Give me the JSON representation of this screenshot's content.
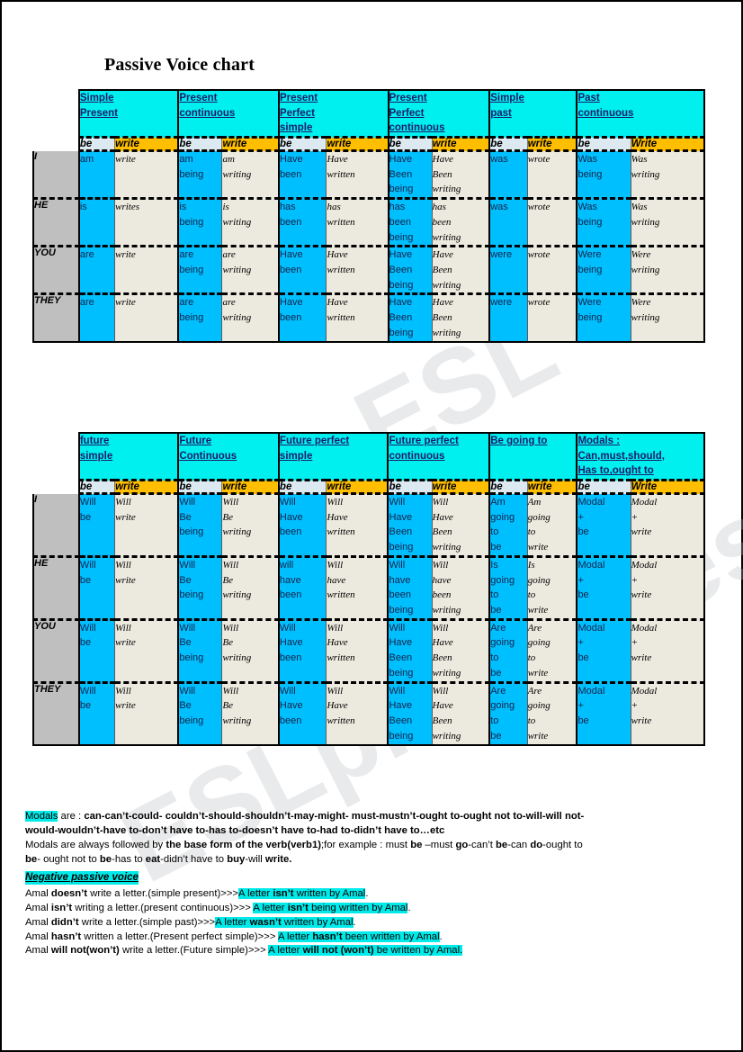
{
  "title": "Passive Voice chart",
  "watermark": [
    "ESLprintables.com",
    "ESL"
  ],
  "columns_sub": {
    "be": "be",
    "write": "write",
    "write_cap": "Write"
  },
  "table1": {
    "tenses": [
      {
        "lines": [
          "Simple",
          "Present"
        ]
      },
      {
        "lines": [
          "Present",
          "continuous"
        ]
      },
      {
        "lines": [
          "Present",
          "Perfect",
          "simple"
        ]
      },
      {
        "lines": [
          "Present",
          "Perfect",
          "continuous"
        ]
      },
      {
        "lines": [
          "Simple",
          "past"
        ]
      },
      {
        "lines": [
          "Past",
          "continuous"
        ]
      }
    ],
    "subheaders": [
      "be",
      "write",
      "be",
      "write",
      "be",
      "write",
      "be",
      "write",
      "be",
      "write",
      "be",
      "Write"
    ],
    "rows": [
      {
        "label": "I",
        "cells": [
          "am",
          "write",
          "am being",
          "am writing",
          "Have been",
          "Have written",
          "Have Been being",
          "Have Been writing",
          "was",
          "wrote",
          "Was being",
          "Was writing"
        ]
      },
      {
        "label": "HE",
        "cells": [
          "is",
          "writes",
          "is being",
          "is writing",
          "has been",
          "has written",
          "has been being",
          "has been writing",
          "was",
          "wrote",
          "Was being",
          "Was writing"
        ]
      },
      {
        "label": "YOU",
        "cells": [
          "are",
          "write",
          "are being",
          "are writing",
          "Have been",
          "Have written",
          "Have Been being",
          "Have Been writing",
          "were",
          "wrote",
          "Were being",
          "Were writing"
        ]
      },
      {
        "label": "THEY",
        "cells": [
          "are",
          "write",
          "are being",
          "are writing",
          "Have been",
          "Have written",
          "Have Been being",
          "Have Been writing",
          "were",
          "wrote",
          "Were being",
          "Were writing"
        ]
      }
    ]
  },
  "table2": {
    "tenses": [
      {
        "lines": [
          "future",
          "simple"
        ]
      },
      {
        "lines": [
          "Future",
          "Continuous"
        ]
      },
      {
        "lines": [
          "Future perfect",
          " simple"
        ]
      },
      {
        "lines": [
          "Future perfect",
          "continuous"
        ]
      },
      {
        "lines": [
          "Be going to"
        ]
      },
      {
        "lines": [
          "Modals :",
          "Can,must,should,",
          "Has to,ought to"
        ]
      }
    ],
    "subheaders": [
      "be",
      "write",
      "be",
      "write",
      "be",
      "write",
      "be",
      "write",
      "be",
      "write",
      "be",
      "Write"
    ],
    "rows": [
      {
        "label": "I",
        "cells": [
          "Will be",
          "Will write",
          "Will Be being",
          "Will Be writing",
          "Will Have been",
          "Will Have written",
          "Will Have Been being",
          "Will Have Been writing",
          "Am going to be",
          "Am going to write",
          "Modal + be",
          "Modal + write"
        ]
      },
      {
        "label": "HE",
        "cells": [
          "Will be",
          "Will write",
          "Will Be being",
          "Will Be writing",
          "will have been",
          "Will have written",
          "Will have been being",
          "Will have been writing",
          "Is going to be",
          "Is going to write",
          "Modal + be",
          "Modal + write"
        ]
      },
      {
        "label": "YOU",
        "cells": [
          "Will be",
          "Will write",
          "Will Be being",
          "Will Be writing",
          "Will Have been",
          "Will Have written",
          "Will Have Been being",
          "Will Have Been writing",
          "Are going to be",
          "Are going to write",
          "Modal + be",
          "Modal + write"
        ]
      },
      {
        "label": "THEY",
        "cells": [
          "Will be",
          "Will write",
          "Will Be being",
          "Will Be writing",
          "Will Have been",
          "Will Have written",
          "Will Have Been being",
          "Will Have Been writing",
          "Are going to be",
          "Are going to write",
          "Modal + be",
          "Modal + write"
        ]
      }
    ]
  },
  "notes": {
    "modals_word": "Modals",
    "modals_are": " are : ",
    "modals_list_line1": "can-can’t-could- couldn’t-should-shouldn’t-may-might- must-mustn’t-ought to-ought not to-will-will not-",
    "modals_list_line2": "would-wouldn’t-have to-don’t have to-has to-doesn’t have to-had to-didn’t have to…etc",
    "followed_pre": "Modals are always followed by ",
    "followed_bold": "the base form of the verb(verb1)",
    "followed_post": ";for example : must ",
    "ex_be1": "be",
    "ex_mid1": " –must ",
    "ex_go": "go",
    "ex_mid2": "-can’t ",
    "ex_be2": "be",
    "ex_mid3": "-can ",
    "ex_do": "do",
    "ex_mid4": "-ought to ",
    "ex_be3": "be",
    "ex_mid5": "- ought not to ",
    "ex_be4": "be",
    "ex_mid6": "-has to ",
    "ex_eat": "eat",
    "ex_mid7": "-didn’t have to ",
    "ex_buy": "buy",
    "ex_mid8": "-will ",
    "ex_write": "write.",
    "negative_title": "Negative passive voice",
    "examples": [
      {
        "subject": "Amal  ",
        "neg": "doesn’t",
        "rest": " write a letter.(simple present)>>>",
        "ans_pre": "A letter ",
        "ans_neg": "isn’t",
        "ans_post": " written by Amal",
        "period": "."
      },
      {
        "subject": "Amal  ",
        "neg": "isn’t",
        "rest": " writing a letter.(present continuous)>>> ",
        "ans_pre": "A letter ",
        "ans_neg": "isn’t",
        "ans_post": " being written by Amal",
        "period": "."
      },
      {
        "subject": "Amal  ",
        "neg": "didn’t",
        "rest": " write a letter.(simple past)>>>",
        "ans_pre": "A letter ",
        "ans_neg": "wasn’t",
        "ans_post": " written by Amal",
        "period": "."
      },
      {
        "subject": "Amal  ",
        "neg": "hasn’t",
        "rest": " written a letter.(Present perfect simple)>>> ",
        "ans_pre": " A letter ",
        "ans_neg": "hasn’t",
        "ans_post": " been written by Amal",
        "period": "."
      },
      {
        "subject": "Amal  ",
        "neg": "will not(won’t)",
        "rest": " write a letter.(Future simple)>>> ",
        "ans_pre": "A letter ",
        "ans_neg": "will not (won’t)",
        "ans_post": " be written by Amal.",
        "period": ""
      }
    ]
  },
  "colors": {
    "tense_header": "#00f0f0",
    "be_subheader": "#dce9f0",
    "write_subheader": "#ffbf00",
    "be_cell": "#00bfff",
    "write_cell": "#ece9de",
    "row_label": "#bfbfbf",
    "highlight": "#00eaea"
  }
}
